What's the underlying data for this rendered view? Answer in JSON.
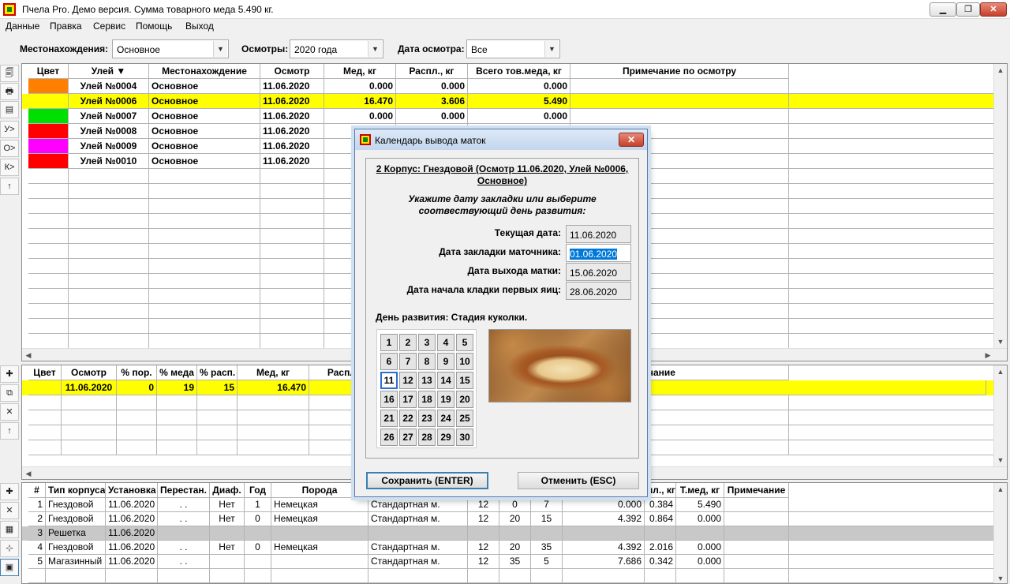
{
  "window": {
    "title": "Пчела Pro. Демо версия. Сумма товарного меда 5.490 кг.",
    "min_glyph": "▁",
    "max_glyph": "❐",
    "close_glyph": "✕"
  },
  "menu": [
    "Данные",
    "Правка",
    "Сервис",
    "Помощь",
    "Выход"
  ],
  "filters": {
    "location_label": "Местонахождения:",
    "location_value": "Основное",
    "inspections_label": "Осмотры:",
    "inspections_value": "2020 года",
    "date_label": "Дата осмотра:",
    "date_value": "Все",
    "dropdown_glyph": "▼"
  },
  "left_toolbar_top": [
    "🗐",
    "🖶",
    "▤",
    "У>",
    "О>",
    "К>",
    "↑"
  ],
  "left_toolbar_mid": [
    "✚",
    "⧉",
    "✕",
    "↑"
  ],
  "left_toolbar_bot": [
    "✚",
    "✕",
    "▦",
    "⊹",
    "▣"
  ],
  "hives_table": {
    "headers": [
      "Цвет",
      "Улей ▼",
      "Местонахождение",
      "Осмотр",
      "Мед, кг",
      "Распл., кг",
      "Всего тов.меда, кг",
      "Примечание по осмотру"
    ],
    "rows": [
      {
        "color": "#ff8000",
        "hive": "Улей №0004",
        "location": "Основное",
        "date": "11.06.2020",
        "honey": "0.000",
        "brood": "0.000",
        "total": "0.000",
        "note": "",
        "selected": false
      },
      {
        "color": "#ffff00",
        "hive": "Улей №0006",
        "location": "Основное",
        "date": "11.06.2020",
        "honey": "16.470",
        "brood": "3.606",
        "total": "5.490",
        "note": "",
        "selected": true
      },
      {
        "color": "#00e000",
        "hive": "Улей №0007",
        "location": "Основное",
        "date": "11.06.2020",
        "honey": "0.000",
        "brood": "0.000",
        "total": "0.000",
        "note": "",
        "selected": false
      },
      {
        "color": "#ff0000",
        "hive": "Улей №0008",
        "location": "Основное",
        "date": "11.06.2020",
        "honey": "0.000",
        "brood": "0.000",
        "total": "0.000",
        "note": "",
        "selected": false
      },
      {
        "color": "#ff00ff",
        "hive": "Улей №0009",
        "location": "Основное",
        "date": "11.06.2020",
        "honey": "",
        "brood": "",
        "total": "",
        "note": "",
        "selected": false
      },
      {
        "color": "#ff0000",
        "hive": "Улей №0010",
        "location": "Основное",
        "date": "11.06.2020",
        "honey": "",
        "brood": "",
        "total": "",
        "note": "",
        "selected": false
      }
    ]
  },
  "inspections_table": {
    "headers": [
      "Цвет",
      "Осмотр",
      "% пор.",
      "% меда",
      "% расп.",
      "Мед, кг",
      "Распло",
      "",
      "",
      "",
      "чание"
    ],
    "rows": [
      {
        "date": "11.06.2020",
        "pct_empty": "0",
        "pct_honey": "19",
        "pct_brood": "15",
        "honey": "16.470",
        "selected": true
      }
    ]
  },
  "bodies_table": {
    "headers": [
      "#",
      "Тип корпуса",
      "Установка",
      "Перестан.",
      "Диаф.",
      "Год",
      "Порода",
      "",
      "",
      "",
      "",
      "пл., кг",
      "Т.мед, кг",
      "Примечание"
    ],
    "rows": [
      {
        "n": "1",
        "type": "Гнездовой",
        "installed": "11.06.2020",
        "moved": ". .",
        "diaph": "Нет",
        "year": "1",
        "breed": "Немецкая",
        "frame": "Стандартная м.",
        "c1": "12",
        "c2": "0",
        "c3": "7",
        "c4": "0.000",
        "c5": "0.384",
        "c6": "5.490",
        "gray": false,
        "cursor": false
      },
      {
        "n": "2",
        "type": "Гнездовой",
        "installed": "11.06.2020",
        "moved": ". .",
        "diaph": "Нет",
        "year": "0",
        "breed": "Немецкая",
        "frame": "Стандартная м.",
        "c1": "12",
        "c2": "20",
        "c3": "15",
        "c4": "4.392",
        "c5": "0.864",
        "c6": "0.000",
        "gray": false,
        "cursor": true
      },
      {
        "n": "3",
        "type": "Решетка",
        "installed": "11.06.2020",
        "moved": "",
        "diaph": "",
        "year": "",
        "breed": "",
        "frame": "",
        "c1": "",
        "c2": "",
        "c3": "",
        "c4": "",
        "c5": "",
        "c6": "",
        "gray": true,
        "cursor": false
      },
      {
        "n": "4",
        "type": "Гнездовой",
        "installed": "11.06.2020",
        "moved": ". .",
        "diaph": "Нет",
        "year": "0",
        "breed": "Немецкая",
        "frame": "Стандартная м.",
        "c1": "12",
        "c2": "20",
        "c3": "35",
        "c4": "4.392",
        "c5": "2.016",
        "c6": "0.000",
        "gray": false,
        "cursor": false
      },
      {
        "n": "5",
        "type": "Магазинный",
        "installed": "11.06.2020",
        "moved": ". .",
        "diaph": "",
        "year": "",
        "breed": "",
        "frame": "Стандартная м.",
        "c1": "12",
        "c2": "35",
        "c3": "5",
        "c4": "7.686",
        "c5": "0.342",
        "c6": "0.000",
        "gray": false,
        "cursor": false
      }
    ]
  },
  "dialog": {
    "title": "Календарь вывода маток",
    "close_glyph": "✕",
    "header_line1": "2 Корпус: Гнездовой (Осмотр 11.06.2020, Улей №0006,",
    "header_line2": "Основное)",
    "prompt_line1": "Укажите дату закладки или выберите",
    "prompt_line2": "соотвествующий день развития:",
    "current_date_label": "Текущая дата:",
    "current_date": "11.06.2020",
    "cell_date_label": "Дата закладки маточника:",
    "cell_date": "01.06.2020",
    "emerge_label": "Дата выхода матки:",
    "emerge_date": "15.06.2020",
    "laying_label": "Дата начала кладки первых яиц:",
    "laying_date": "28.06.2020",
    "dev_label": "День развития:  Стадия куколки.",
    "days": [
      "1",
      "2",
      "3",
      "4",
      "5",
      "6",
      "7",
      "8",
      "9",
      "10",
      "11",
      "12",
      "13",
      "14",
      "15",
      "16",
      "17",
      "18",
      "19",
      "20",
      "21",
      "22",
      "23",
      "24",
      "25",
      "26",
      "27",
      "28",
      "29",
      "30"
    ],
    "selected_day": "11",
    "save_label": "Сохранить (ENTER)",
    "cancel_label": "Отменить (ESC)"
  },
  "scroll": {
    "up": "▲",
    "down": "▼",
    "left": "◀",
    "right": "▶"
  }
}
